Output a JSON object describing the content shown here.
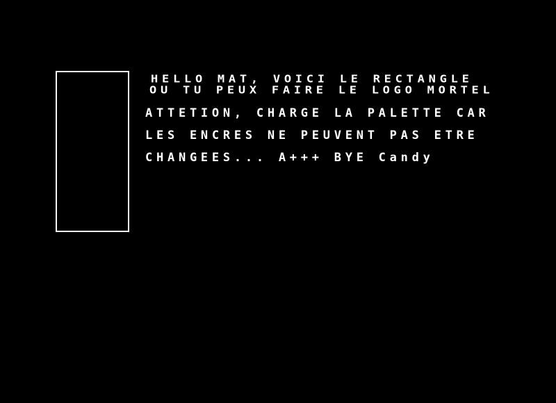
{
  "screen": {
    "background": "#000000",
    "foreground": "#ffffff",
    "lines": [
      "HELLO MAT, VOICI LE RECTANGLE",
      "OU TU PEUX FAIRE LE LOGO MORTEL",
      "ATTETION, CHARGE LA PALETTE CAR",
      "LES ENCRES NE PEUVENT PAS ETRE",
      "CHANGEES... A+++ BYE Candy"
    ]
  }
}
